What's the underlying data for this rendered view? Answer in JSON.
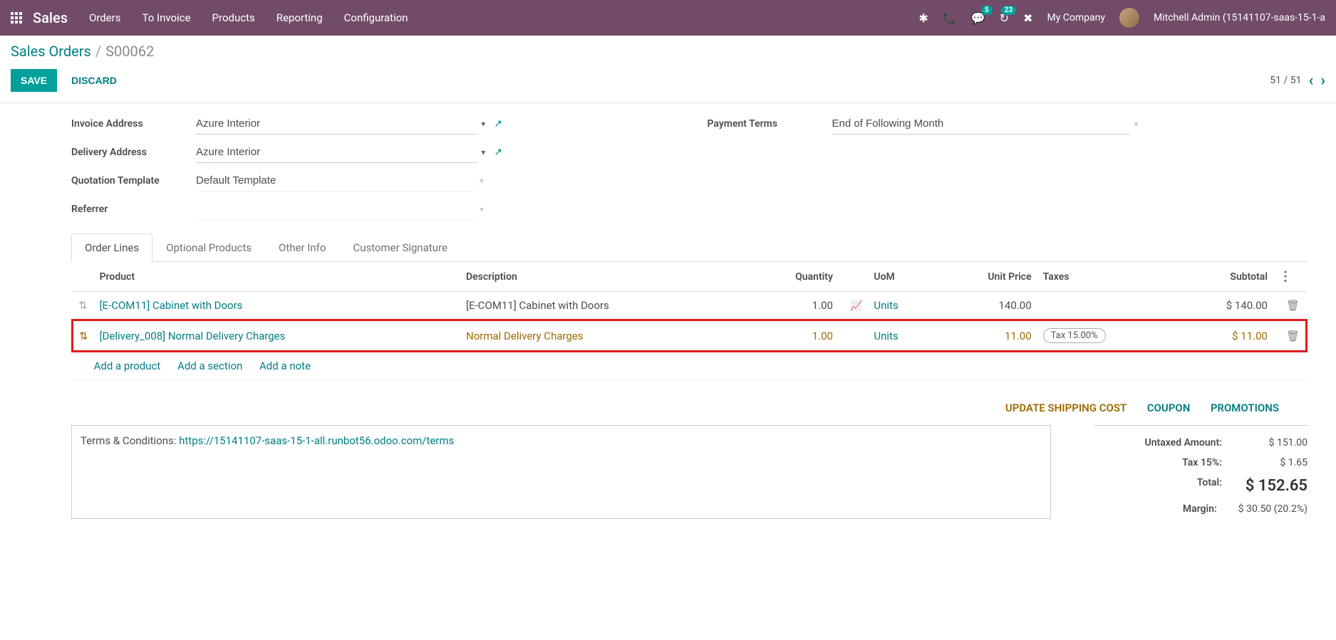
{
  "nav": {
    "app_title": "Sales",
    "items": [
      "Orders",
      "To Invoice",
      "Products",
      "Reporting",
      "Configuration"
    ],
    "chat_badge": "5",
    "activity_badge": "23",
    "company": "My Company",
    "user": "Mitchell Admin (15141107-saas-15-1-a"
  },
  "breadcrumb": {
    "root": "Sales Orders",
    "current": "S00062"
  },
  "actions": {
    "save": "SAVE",
    "discard": "DISCARD",
    "pager": "51 / 51"
  },
  "form": {
    "invoice_address": {
      "label": "Invoice Address",
      "value": "Azure Interior"
    },
    "delivery_address": {
      "label": "Delivery Address",
      "value": "Azure Interior"
    },
    "quotation_template": {
      "label": "Quotation Template",
      "value": "Default Template"
    },
    "referrer": {
      "label": "Referrer",
      "value": ""
    },
    "payment_terms": {
      "label": "Payment Terms",
      "value": "End of Following Month"
    }
  },
  "tabs": [
    "Order Lines",
    "Optional Products",
    "Other Info",
    "Customer Signature"
  ],
  "table": {
    "headers": {
      "product": "Product",
      "description": "Description",
      "quantity": "Quantity",
      "uom": "UoM",
      "unit_price": "Unit Price",
      "taxes": "Taxes",
      "subtotal": "Subtotal"
    },
    "rows": [
      {
        "product": "[E-COM11] Cabinet with Doors",
        "description": "[E-COM11] Cabinet with Doors",
        "quantity": "1.00",
        "uom": "Units",
        "unit_price": "140.00",
        "taxes": "",
        "subtotal": "$ 140.00",
        "has_chart": true
      },
      {
        "product": "[Delivery_008] Normal Delivery Charges",
        "description": "Normal Delivery Charges",
        "quantity": "1.00",
        "uom": "Units",
        "unit_price": "11.00",
        "taxes": "Tax 15.00%",
        "subtotal": "$ 11.00",
        "highlight": true
      }
    ],
    "add_links": {
      "product": "Add a product",
      "section": "Add a section",
      "note": "Add a note"
    }
  },
  "footer_buttons": {
    "update_shipping": "UPDATE SHIPPING COST",
    "coupon": "COUPON",
    "promotions": "PROMOTIONS"
  },
  "terms": {
    "prefix": "Terms & Conditions: ",
    "link": "https://15141107-saas-15-1-all.runbot56.odoo.com/terms"
  },
  "totals": {
    "untaxed": {
      "label": "Untaxed Amount:",
      "value": "$ 151.00"
    },
    "tax": {
      "label": "Tax 15%:",
      "value": "$ 1.65"
    },
    "total": {
      "label": "Total:",
      "value": "$ 152.65"
    },
    "margin": {
      "label": "Margin:",
      "value": "$ 30.50 (20.2%)"
    }
  }
}
